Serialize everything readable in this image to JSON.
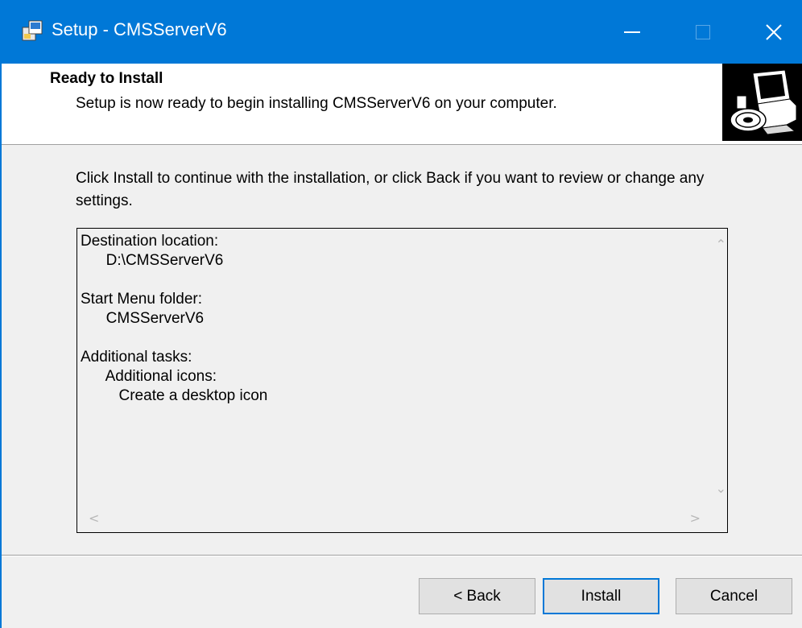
{
  "window": {
    "title": "Setup - CMSServerV6",
    "accent_color": "#0078d7",
    "controls": {
      "minimize_icon": "minimize-icon",
      "maximize_icon": "maximize-icon",
      "close_icon": "close-icon",
      "close_label": "✕"
    }
  },
  "header": {
    "title": "Ready to Install",
    "subtitle": "Setup is now ready to begin installing CMSServerV6 on your computer.",
    "image_icon": "computer-setup-icon"
  },
  "body": {
    "intro": "Click Install to continue with the installation, or click Back if you want to review or change any settings.",
    "summary": [
      "Destination location:",
      "      D:\\CMSServerV6",
      "",
      "Start Menu folder:",
      "      CMSServerV6",
      "",
      "Additional tasks:",
      "      Additional icons:",
      "         Create a desktop icon"
    ],
    "scroll_arrows": {
      "up": "⌃",
      "down": "⌄",
      "left": "<",
      "right": ">"
    }
  },
  "footer": {
    "back_label": "< Back",
    "install_label": "Install",
    "cancel_label": "Cancel"
  }
}
